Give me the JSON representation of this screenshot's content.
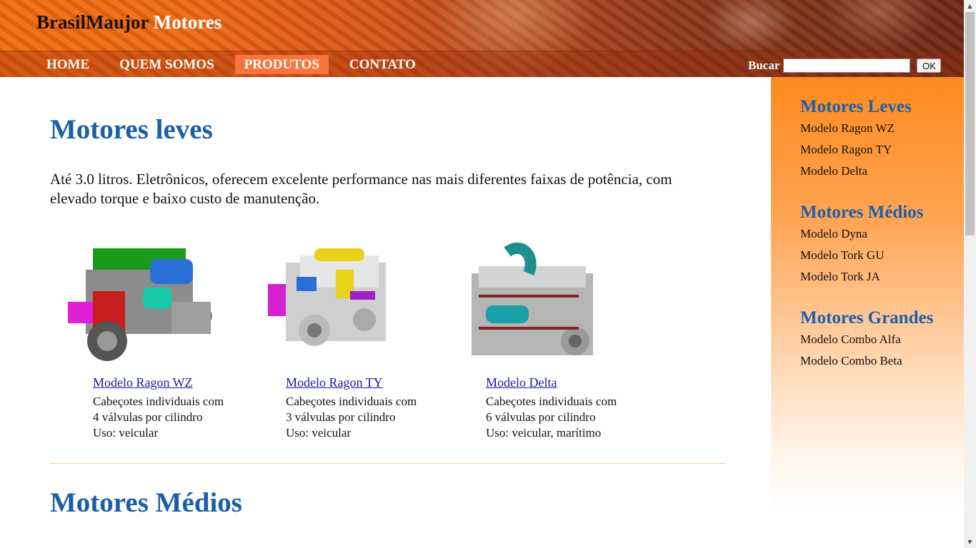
{
  "header": {
    "brand_part1": "BrasilMaujor",
    "brand_part2": "Motores",
    "nav": [
      "HOME",
      "QUEM SOMOS",
      "PRODUTOS",
      "CONTATO"
    ],
    "active_nav": "PRODUTOS",
    "search_label": "Bucar",
    "search_value": "",
    "search_button": "OK"
  },
  "main": {
    "section1": {
      "title": "Motores leves",
      "intro": "Até 3.0 litros. Eletrônicos, oferecem excelente performance nas mais diferentes faixas de potência, com elevado torque e baixo custo de manutenção.",
      "products": [
        {
          "name": "Modelo Ragon WZ",
          "line1": "Cabeçotes individuais com",
          "line2": "4 válvulas por cilindro",
          "line3": "Uso: veicular",
          "icon": "engine-image"
        },
        {
          "name": "Modelo Ragon TY",
          "line1": "Cabeçotes individuais com",
          "line2": "3 válvulas por cilindro",
          "line3": "Uso: veicular",
          "icon": "engine-image"
        },
        {
          "name": "Modelo Delta",
          "line1": "Cabeçotes individuais com",
          "line2": "6 válvulas por cilindro",
          "line3": "Uso: veicular, marítimo",
          "icon": "engine-image"
        }
      ]
    },
    "section2": {
      "title": "Motores Médios"
    }
  },
  "sidebar": {
    "groups": [
      {
        "title": "Motores Leves",
        "items": [
          "Modelo Ragon WZ",
          "Modelo Ragon TY",
          "Modelo Delta"
        ]
      },
      {
        "title": "Motores Médios",
        "items": [
          "Modelo Dyna",
          "Modelo Tork GU",
          "Modelo Tork JA"
        ]
      },
      {
        "title": "Motores Grandes",
        "items": [
          "Modelo Combo Alfa",
          "Modelo Combo Beta"
        ]
      }
    ]
  },
  "colors": {
    "header_orange": "#f36c10",
    "heading_blue": "#1a5fa8",
    "active_tab": "#f7743c",
    "link_blue": "#1a1aa6",
    "divider": "#f0d08a"
  }
}
